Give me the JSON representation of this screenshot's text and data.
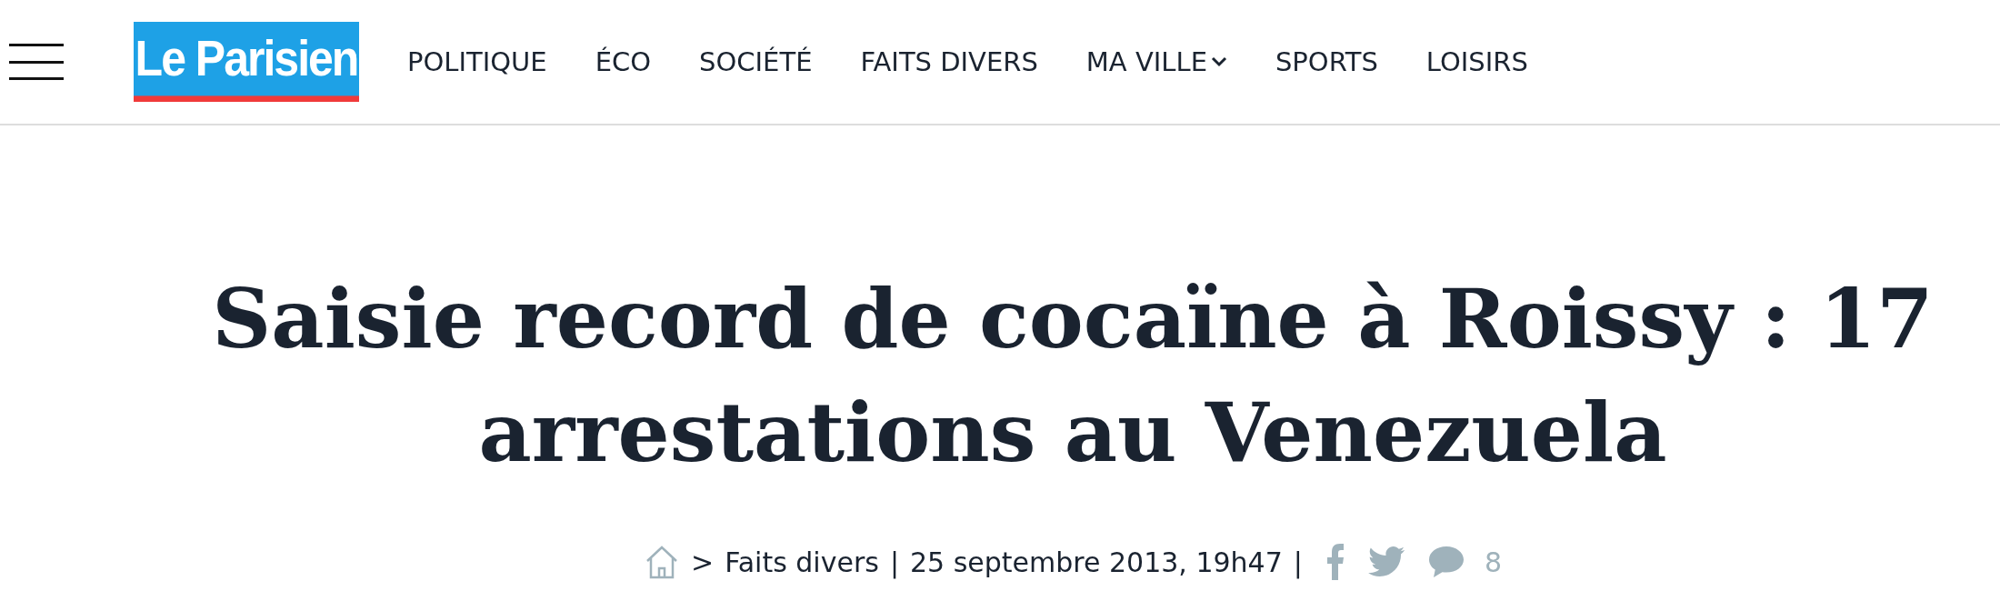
{
  "header": {
    "logo": "Le Parisien",
    "nav": [
      {
        "label": "POLITIQUE",
        "dropdown": false
      },
      {
        "label": "ÉCO",
        "dropdown": false
      },
      {
        "label": "SOCIÉTÉ",
        "dropdown": false
      },
      {
        "label": "FAITS DIVERS",
        "dropdown": false
      },
      {
        "label": "MA VILLE",
        "dropdown": true
      },
      {
        "label": "SPORTS",
        "dropdown": false
      },
      {
        "label": "LOISIRS",
        "dropdown": false
      }
    ]
  },
  "article": {
    "headline": "Saisie record de cocaïne à Roissy : 17 arrestations au Venezuela",
    "meta": {
      "separator": ">",
      "section": "Faits divers",
      "divider_1": "|",
      "date": "25 septembre 2013, 19h47",
      "divider_2": "|",
      "comment_count": "8"
    }
  }
}
